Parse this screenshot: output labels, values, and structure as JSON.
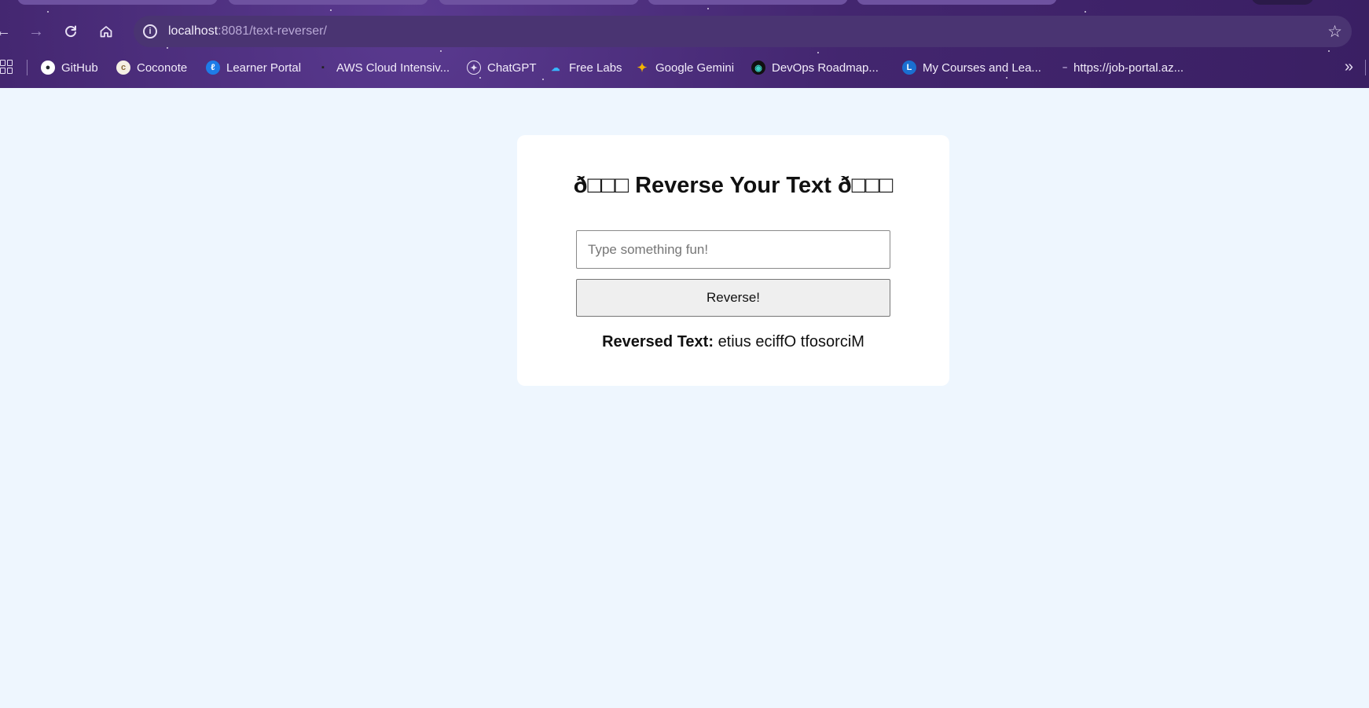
{
  "browser": {
    "url_host": "localhost",
    "url_rest": ":8081/text-reverser/",
    "bookmarks": [
      {
        "label": "GitHub",
        "icon": "github-icon"
      },
      {
        "label": "Coconote",
        "icon": "coconote-icon"
      },
      {
        "label": "Learner Portal",
        "icon": "learner-portal-icon"
      },
      {
        "label": "AWS Cloud Intensiv...",
        "icon": "aws-icon"
      },
      {
        "label": "ChatGPT",
        "icon": "chatgpt-icon"
      },
      {
        "label": "Free Labs",
        "icon": "free-labs-icon"
      },
      {
        "label": "Google Gemini",
        "icon": "gemini-icon"
      },
      {
        "label": "DevOps Roadmap...",
        "icon": "devops-icon"
      },
      {
        "label": "My Courses and Lea...",
        "icon": "courses-icon"
      },
      {
        "label": "https://job-portal.az...",
        "icon": "link-icon"
      }
    ]
  },
  "app": {
    "title": "ð□□□ Reverse Your Text ð□□□",
    "input_placeholder": "Type something fun!",
    "input_value": "",
    "button_label": "Reverse!",
    "result_label": "Reversed Text:",
    "result_value": "etius eciffO tfosorciM"
  },
  "colors": {
    "page_background": "#eef6fe",
    "card_background": "#ffffff",
    "chrome_purple": "#43266f"
  }
}
